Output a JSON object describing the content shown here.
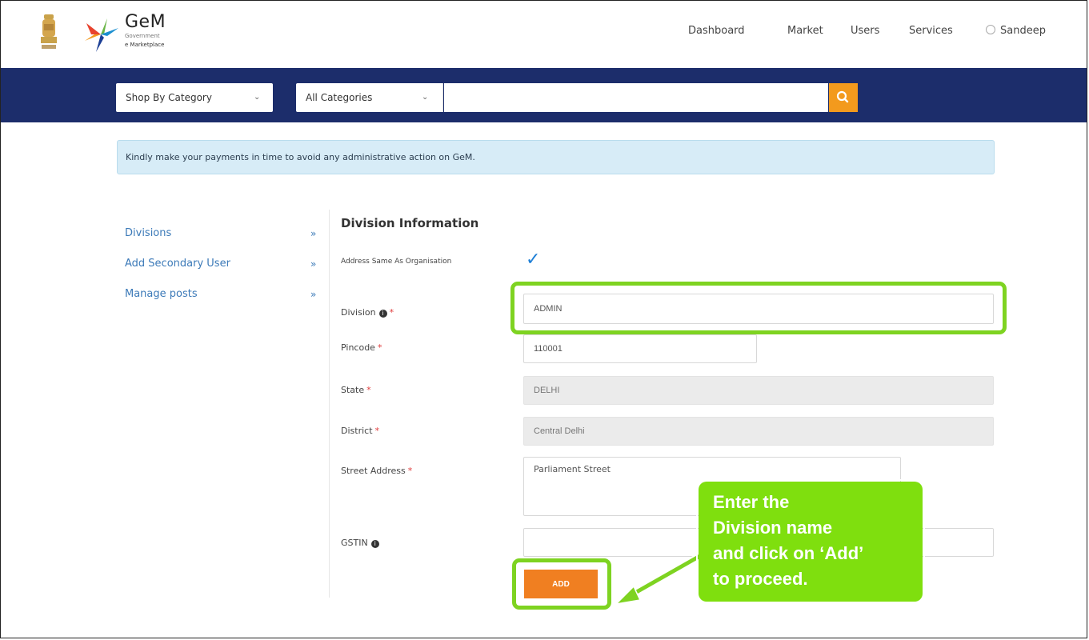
{
  "brand": {
    "name": "GeM",
    "sub_line1": "Government",
    "sub_line2": "e Marketplace"
  },
  "nav": {
    "dashboard": "Dashboard",
    "market": "Market",
    "users": "Users",
    "services": "Services",
    "user_name": "Sandeep"
  },
  "search": {
    "shop_by": "Shop By Category",
    "category": "All Categories",
    "query": ""
  },
  "alert": {
    "text": "Kindly make your payments in time to avoid any administrative action on GeM."
  },
  "sidebar": {
    "items": [
      {
        "label": "Divisions",
        "arrow": "»"
      },
      {
        "label": "Add Secondary User",
        "arrow": "»"
      },
      {
        "label": "Manage posts",
        "arrow": "»"
      }
    ]
  },
  "form": {
    "title": "Division Information",
    "address_same_label": "Address Same As Organisation",
    "address_same_checked": true,
    "division_label": "Division",
    "division_value": "ADMIN",
    "pincode_label": "Pincode",
    "pincode_value": "110001",
    "state_label": "State",
    "state_value": "DELHI",
    "district_label": "District",
    "district_value": "Central Delhi",
    "street_label": "Street Address",
    "street_value": "Parliament Street",
    "gstin_label": "GSTIN",
    "gstin_value": "",
    "add_button": "ADD"
  },
  "callout": {
    "line1": "Enter the",
    "line2": "Division name",
    "line3": "and click on ‘Add’",
    "line4": "to proceed."
  },
  "colors": {
    "navy_bar": "#1c2d6b",
    "search_orange": "#f39a1d",
    "add_orange": "#f07f21",
    "highlight_green": "#7ed321",
    "callout_green": "#7fdf0e",
    "link_blue": "#3c7ab8"
  }
}
